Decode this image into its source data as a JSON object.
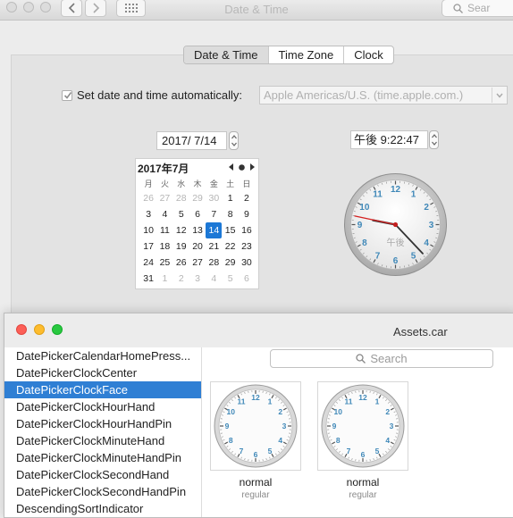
{
  "prefs": {
    "title": "Date & Time",
    "search_placeholder": "Sear",
    "tabs": [
      "Date & Time",
      "Time Zone",
      "Clock"
    ],
    "auto_label": "Set date and time automatically:",
    "auto_checked": true,
    "server": "Apple Americas/U.S. (time.apple.com.)",
    "date_value": "2017/  7/14",
    "time_value": "午後  9:22:47",
    "calendar": {
      "month_label": "2017年7月",
      "weekdays": [
        "月",
        "火",
        "水",
        "木",
        "金",
        "土",
        "日"
      ],
      "weeks": [
        [
          "26",
          "27",
          "28",
          "29",
          "30",
          "1",
          "2"
        ],
        [
          "3",
          "4",
          "5",
          "6",
          "7",
          "8",
          "9"
        ],
        [
          "10",
          "11",
          "12",
          "13",
          "14",
          "15",
          "16"
        ],
        [
          "17",
          "18",
          "19",
          "20",
          "21",
          "22",
          "23"
        ],
        [
          "24",
          "25",
          "26",
          "27",
          "28",
          "29",
          "30"
        ],
        [
          "31",
          "1",
          "2",
          "3",
          "4",
          "5",
          "6"
        ]
      ],
      "selected": "14"
    },
    "clock": {
      "ampm": "午後",
      "numbers": [
        "12",
        "1",
        "2",
        "3",
        "4",
        "5",
        "6",
        "7",
        "8",
        "9",
        "10",
        "11"
      ],
      "hour": 9,
      "minute": 22,
      "second": 47
    }
  },
  "assets": {
    "title": "Assets.car",
    "search_placeholder": "Search",
    "items": [
      "DatePickerCalendarHomePress...",
      "DatePickerClockCenter",
      "DatePickerClockFace",
      "DatePickerClockHourHand",
      "DatePickerClockHourHandPin",
      "DatePickerClockMinuteHand",
      "DatePickerClockMinuteHandPin",
      "DatePickerClockSecondHand",
      "DatePickerClockSecondHandPin",
      "DescendingSortIndicator"
    ],
    "active_index": 2,
    "thumbs": [
      {
        "label": "normal",
        "sub": "regular"
      },
      {
        "label": "normal",
        "sub": "regular"
      }
    ]
  }
}
